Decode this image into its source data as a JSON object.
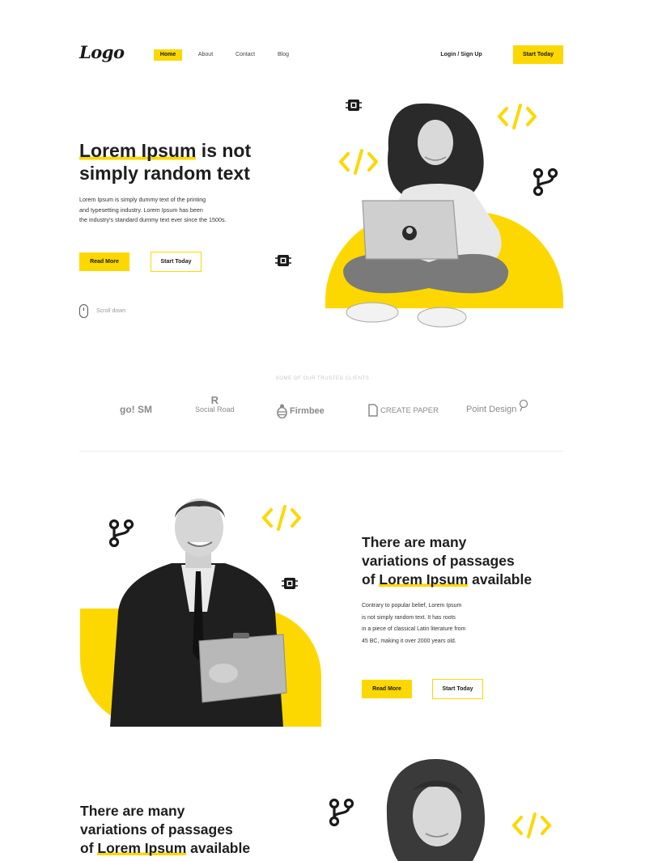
{
  "header": {
    "logo": "Logo",
    "nav": [
      "Home",
      "About",
      "Contact",
      "Blog"
    ],
    "login": "Login / Sign Up",
    "cta": "Start Today"
  },
  "hero": {
    "title_highlight": "Lorem Ipsum",
    "title_rest1": " is not",
    "title_line2": "simply random text",
    "desc_lines": [
      "Lorem Ipsum is simply dummy text of the printing",
      "and typesetting industry. Lorem Ipsum has been",
      "the industry's standard dummy text ever since the 1500s."
    ],
    "btn_primary": "Read More",
    "btn_secondary": "Start Today",
    "scroll": "Scroll down"
  },
  "clients": {
    "label": "SOME OF OUR TRUSTED CLIENTS",
    "items": [
      "go! SM",
      "Social Road",
      "Firmbee",
      "CREATE PAPER",
      "Point Design"
    ]
  },
  "section2": {
    "title_line1": "There are many",
    "title_line2": "variations of passages",
    "title_of": "of ",
    "title_highlight": "Lorem Ipsum",
    "title_rest": " available",
    "desc_lines": [
      "Contrary to popular belief, Lorem Ipsum",
      "is not simply random text. It has roots",
      "in a piece of classical Latin literature from",
      "45 BC, making it over 2000 years old."
    ],
    "btn_primary": "Read More",
    "btn_secondary": "Start Today"
  },
  "section3": {
    "title_line1": "There are many",
    "title_line2": "variations of passages",
    "title_of": "of ",
    "title_highlight": "Lorem Ipsum",
    "title_rest": " available"
  },
  "colors": {
    "accent": "#fcd800",
    "text": "#1e1e1e"
  }
}
